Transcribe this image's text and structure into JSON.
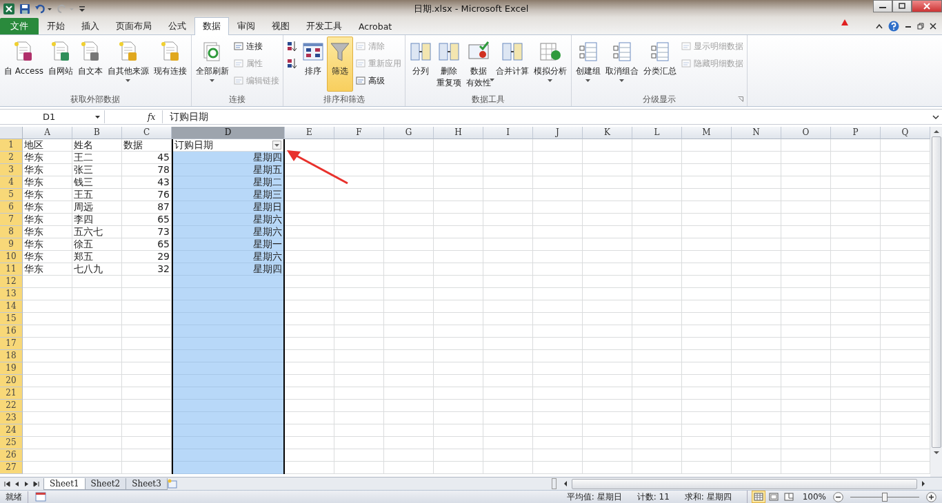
{
  "window": {
    "title": "日期.xlsx  -  Microsoft Excel"
  },
  "tabs": [
    {
      "label": "文件",
      "selected": false,
      "kind": "file"
    },
    {
      "label": "开始",
      "selected": false,
      "kind": "tab"
    },
    {
      "label": "插入",
      "selected": false,
      "kind": "tab"
    },
    {
      "label": "页面布局",
      "selected": false,
      "kind": "tab"
    },
    {
      "label": "公式",
      "selected": false,
      "kind": "tab"
    },
    {
      "label": "数据",
      "selected": true,
      "kind": "tab"
    },
    {
      "label": "审阅",
      "selected": false,
      "kind": "tab"
    },
    {
      "label": "视图",
      "selected": false,
      "kind": "tab"
    },
    {
      "label": "开发工具",
      "selected": false,
      "kind": "tab"
    },
    {
      "label": "Acrobat",
      "selected": false,
      "kind": "tab"
    }
  ],
  "ribbon_groups": [
    {
      "label": "获取外部数据",
      "launcher": false,
      "items": [
        {
          "kind": "large",
          "lines": [
            "自 Access"
          ],
          "dropdown": false,
          "selected": false
        },
        {
          "kind": "large",
          "lines": [
            "自网站"
          ],
          "dropdown": false,
          "selected": false
        },
        {
          "kind": "large",
          "lines": [
            "自文本"
          ],
          "dropdown": false,
          "selected": false
        },
        {
          "kind": "large",
          "lines": [
            "自其他来源"
          ],
          "dropdown": true,
          "selected": false
        },
        {
          "kind": "large",
          "lines": [
            "现有连接"
          ],
          "dropdown": false,
          "selected": false
        }
      ]
    },
    {
      "label": "连接",
      "launcher": false,
      "items": [
        {
          "kind": "large",
          "lines": [
            "全部刷新"
          ],
          "dropdown": true,
          "selected": false
        },
        {
          "kind": "stack",
          "items": [
            {
              "label": "连接",
              "disabled": false
            },
            {
              "label": "属性",
              "disabled": true
            },
            {
              "label": "编辑链接",
              "disabled": true
            }
          ]
        }
      ]
    },
    {
      "label": "排序和筛选",
      "launcher": false,
      "items": [
        {
          "kind": "stack",
          "items": [
            {
              "disabled": false
            },
            {
              "disabled": false
            }
          ]
        },
        {
          "kind": "large",
          "lines": [
            "排序"
          ],
          "dropdown": false,
          "selected": false
        },
        {
          "kind": "large",
          "lines": [
            "筛选"
          ],
          "dropdown": false,
          "selected": true
        },
        {
          "kind": "stack",
          "items": [
            {
              "label": "清除",
              "disabled": true
            },
            {
              "label": "重新应用",
              "disabled": true
            },
            {
              "label": "高级",
              "disabled": false
            }
          ]
        }
      ]
    },
    {
      "label": "数据工具",
      "launcher": false,
      "items": [
        {
          "kind": "large",
          "lines": [
            "分列"
          ],
          "dropdown": false,
          "selected": false
        },
        {
          "kind": "large",
          "lines": [
            "删除",
            "重复项"
          ],
          "dropdown": false,
          "selected": false
        },
        {
          "kind": "large",
          "lines": [
            "数据",
            "有效性"
          ],
          "dropdown": true,
          "selected": false
        },
        {
          "kind": "large",
          "lines": [
            "合并计算"
          ],
          "dropdown": false,
          "selected": false
        },
        {
          "kind": "large",
          "lines": [
            "模拟分析"
          ],
          "dropdown": true,
          "selected": false
        }
      ]
    },
    {
      "label": "分级显示",
      "launcher": true,
      "items": [
        {
          "kind": "large",
          "lines": [
            "创建组"
          ],
          "dropdown": true,
          "selected": false
        },
        {
          "kind": "large",
          "lines": [
            "取消组合"
          ],
          "dropdown": true,
          "selected": false
        },
        {
          "kind": "large",
          "lines": [
            "分类汇总"
          ],
          "dropdown": false,
          "selected": false
        },
        {
          "kind": "stack",
          "items": [
            {
              "label": "显示明细数据",
              "disabled": true
            },
            {
              "label": "隐藏明细数据",
              "disabled": true
            }
          ]
        }
      ]
    }
  ],
  "name_box": "D1",
  "function_button": "fx",
  "formula": "订购日期",
  "columns": [
    {
      "label": "A",
      "selected": false,
      "filter": false
    },
    {
      "label": "B",
      "selected": false,
      "filter": false
    },
    {
      "label": "C",
      "selected": false,
      "filter": false
    },
    {
      "label": "D",
      "selected": true,
      "filter": true
    },
    {
      "label": "E",
      "selected": false,
      "filter": false
    },
    {
      "label": "F",
      "selected": false,
      "filter": false
    },
    {
      "label": "G",
      "selected": false,
      "filter": false
    },
    {
      "label": "H",
      "selected": false,
      "filter": false
    },
    {
      "label": "I",
      "selected": false,
      "filter": false
    },
    {
      "label": "J",
      "selected": false,
      "filter": false
    },
    {
      "label": "K",
      "selected": false,
      "filter": false
    },
    {
      "label": "L",
      "selected": false,
      "filter": false
    },
    {
      "label": "M",
      "selected": false,
      "filter": false
    },
    {
      "label": "N",
      "selected": false,
      "filter": false
    },
    {
      "label": "O",
      "selected": false,
      "filter": false
    },
    {
      "label": "P",
      "selected": false,
      "filter": false
    },
    {
      "label": "Q",
      "selected": false,
      "filter": false
    }
  ],
  "rows": [
    {
      "header": "1",
      "cells": [
        "地区",
        "姓名",
        "数据",
        "订购日期"
      ]
    },
    {
      "header": "2",
      "cells": [
        "华东",
        "王二",
        "45",
        "星期四"
      ]
    },
    {
      "header": "3",
      "cells": [
        "华东",
        "张三",
        "78",
        "星期五"
      ]
    },
    {
      "header": "4",
      "cells": [
        "华东",
        "钱三",
        "43",
        "星期二"
      ]
    },
    {
      "header": "5",
      "cells": [
        "华东",
        "王五",
        "76",
        "星期三"
      ]
    },
    {
      "header": "6",
      "cells": [
        "华东",
        "周远",
        "87",
        "星期日"
      ]
    },
    {
      "header": "7",
      "cells": [
        "华东",
        "李四",
        "65",
        "星期六"
      ]
    },
    {
      "header": "8",
      "cells": [
        "华东",
        "五六七",
        "73",
        "星期六"
      ]
    },
    {
      "header": "9",
      "cells": [
        "华东",
        "徐五",
        "65",
        "星期一"
      ]
    },
    {
      "header": "10",
      "cells": [
        "华东",
        "郑五",
        "29",
        "星期六"
      ]
    },
    {
      "header": "11",
      "cells": [
        "华东",
        "七八九",
        "32",
        "星期四"
      ]
    },
    {
      "header": "12"
    },
    {
      "header": "13"
    },
    {
      "header": "14"
    },
    {
      "header": "15"
    },
    {
      "header": "16"
    },
    {
      "header": "17"
    },
    {
      "header": "18"
    },
    {
      "header": "19"
    },
    {
      "header": "20"
    },
    {
      "header": "21"
    },
    {
      "header": "22"
    },
    {
      "header": "23"
    },
    {
      "header": "24"
    },
    {
      "header": "25"
    },
    {
      "header": "26"
    },
    {
      "header": "27"
    }
  ],
  "sheets": [
    {
      "label": "Sheet1",
      "selected": true
    },
    {
      "label": "Sheet2",
      "selected": false
    },
    {
      "label": "Sheet3",
      "selected": false
    }
  ],
  "status_bar": {
    "mode": "就绪",
    "stats": [
      "平均值: 星期日",
      "计数: 11",
      "求和: 星期四"
    ],
    "view_modes": [
      {
        "kind": "normal",
        "selected": true
      },
      {
        "kind": "page-layout",
        "selected": false
      },
      {
        "kind": "page-break",
        "selected": false
      }
    ],
    "zoom": "100%",
    "zoom_slider": {
      "level": 0.5
    }
  }
}
